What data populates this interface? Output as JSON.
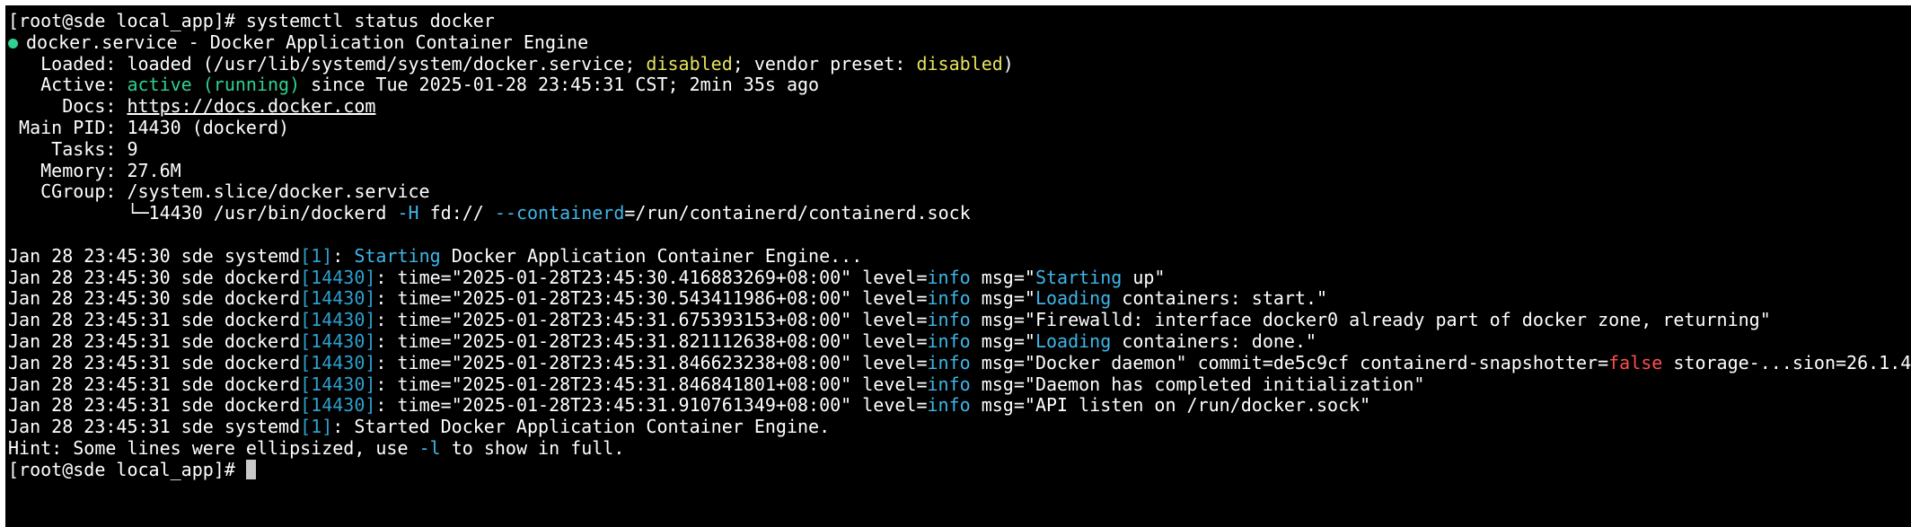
{
  "colors": {
    "background": "#000000",
    "text": "#ffffff",
    "active_green": "#2fd18f",
    "disabled_yellow": "#e8e35a",
    "highlight_cyan": "#3fb6e9",
    "false_red": "#ff4e4e",
    "cursor": "#c8c8c8"
  },
  "terminal": {
    "prompt": "[root@sde local_app]# ",
    "command": "systemctl status docker",
    "status_icon": "status-dot-icon",
    "unit_header": "docker.service - Docker Application Container Engine",
    "loaded": {
      "label": "   Loaded: ",
      "text1": "loaded (/usr/lib/systemd/system/docker.service; ",
      "state": "disabled",
      "text2": "; vendor preset: ",
      "preset": "disabled",
      "text3": ")"
    },
    "active": {
      "label": "   Active: ",
      "state": "active (running)",
      "since": " since Tue 2025-01-28 23:45:31 CST; 2min 35s ago"
    },
    "docs": {
      "label": "     Docs: ",
      "url": "https://docs.docker.com"
    },
    "main_pid": " Main PID: 14430 (dockerd)",
    "tasks": "    Tasks: 9",
    "memory": "   Memory: 27.6M",
    "cgroup": "   CGroup: /system.slice/docker.service",
    "cgroup_child": {
      "prefix": "           └─14430 /usr/bin/dockerd ",
      "flag1": "-H",
      "mid": " fd:// ",
      "flag2": "--containerd",
      "suffix": "=/run/containerd/containerd.sock"
    },
    "logs": [
      {
        "prefix": "Jan 28 23:45:30 sde systemd",
        "pid": "[1]",
        "kind": "plain_cyan",
        "a": ": ",
        "b": "Starting",
        "c": " Docker Application Container Engine..."
      },
      {
        "prefix": "Jan 28 23:45:30 sde dockerd",
        "pid": "[14430]",
        "time": ": time=\"2025-01-28T23:45:30.416883269+08:00\" ",
        "level": "info",
        "m1": "\"",
        "m2": "Starting",
        "m3": " up\""
      },
      {
        "prefix": "Jan 28 23:45:30 sde dockerd",
        "pid": "[14430]",
        "time": ": time=\"2025-01-28T23:45:30.543411986+08:00\" ",
        "level": "info",
        "m1": "\"",
        "m2": "Loading",
        "m3": " containers: start.\""
      },
      {
        "prefix": "Jan 28 23:45:31 sde dockerd",
        "pid": "[14430]",
        "time": ": time=\"2025-01-28T23:45:31.675393153+08:00\" ",
        "level": "info",
        "m1": "\"Firewalld: interface docker0 already part of docker zone, returning\"",
        "m2": "",
        "m3": ""
      },
      {
        "prefix": "Jan 28 23:45:31 sde dockerd",
        "pid": "[14430]",
        "time": ": time=\"2025-01-28T23:45:31.821112638+08:00\" ",
        "level": "info",
        "m1": "\"",
        "m2": "Loading",
        "m3": " containers: done.\""
      },
      {
        "prefix": "Jan 28 23:45:31 sde dockerd",
        "pid": "[14430]",
        "time": ": time=\"2025-01-28T23:45:31.846623238+08:00\" ",
        "level": "info",
        "m1": "\"Docker daemon\" commit=de5c9cf containerd-snapshotter=",
        "m2": "false",
        "m3": " storage-...sion=26.1.4"
      },
      {
        "prefix": "Jan 28 23:45:31 sde dockerd",
        "pid": "[14430]",
        "time": ": time=\"2025-01-28T23:45:31.846841801+08:00\" ",
        "level": "info",
        "m1": "\"Daemon has completed initialization\"",
        "m2": "",
        "m3": ""
      },
      {
        "prefix": "Jan 28 23:45:31 sde dockerd",
        "pid": "[14430]",
        "time": ": time=\"2025-01-28T23:45:31.910761349+08:00\" ",
        "level": "info",
        "m1": "\"API listen on /run/docker.sock\"",
        "m2": "",
        "m3": ""
      },
      {
        "prefix": "Jan 28 23:45:31 sde systemd",
        "pid": "[1]",
        "kind": "plain",
        "a": ": Started Docker Application Container Engine.",
        "b": "",
        "c": ""
      }
    ],
    "level_prefix": "level=",
    "msg_prefix": " msg=",
    "hint": {
      "a": "Hint: Some lines were ellipsized, use ",
      "b": "-l",
      "c": " to show in full."
    },
    "final_prompt": "[root@sde local_app]# "
  }
}
